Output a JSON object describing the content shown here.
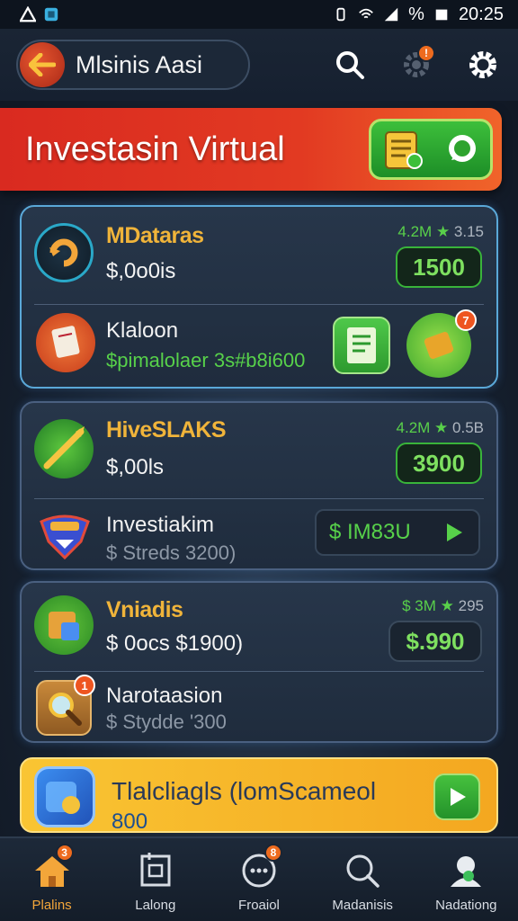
{
  "status_bar": {
    "time": "20:25",
    "battery": "%"
  },
  "header": {
    "title": "Mlsinis Aasi"
  },
  "banner": {
    "title": "Investasin Virtual"
  },
  "cards": [
    {
      "name": "MDataras",
      "balance": "$,0o0is",
      "rating": "4.2M",
      "rating_secondary": "3.15",
      "amount": "1500",
      "row": {
        "title": "Klaloon",
        "subtitle": "$pimalolaer 3s#b8i600",
        "badge": "7"
      }
    },
    {
      "name": "HiveSLAKS",
      "balance": "$,00ls",
      "rating": "4.2M",
      "rating_secondary": "0.5B",
      "amount": "3900",
      "row": {
        "title": "Investiakim",
        "subtitle": "$ Streds 3200)",
        "button_label": "$ IM83U"
      }
    },
    {
      "name": "Vniadis",
      "balance": "$ 0ocs $1900)",
      "rating": "$ 3M",
      "rating_secondary": "295",
      "amount": "$.990",
      "row": {
        "title": "Narotaasion",
        "subtitle": "$ Stydde '300",
        "badge": "1"
      }
    }
  ],
  "promo": {
    "title": "Tlalcliagls (lomScameol",
    "subtitle": "800"
  },
  "nav": [
    {
      "label": "Plalins",
      "icon": "home-icon",
      "badge": "3"
    },
    {
      "label": "Lalong",
      "icon": "document-icon"
    },
    {
      "label": "Froaiol",
      "icon": "chat-icon",
      "badge": "8"
    },
    {
      "label": "Madanisis",
      "icon": "search-icon"
    },
    {
      "label": "Nadationg",
      "icon": "profile-icon"
    }
  ],
  "colors": {
    "accent": "#f3a63a",
    "banner": "#d92a20",
    "green": "#57d14a"
  }
}
